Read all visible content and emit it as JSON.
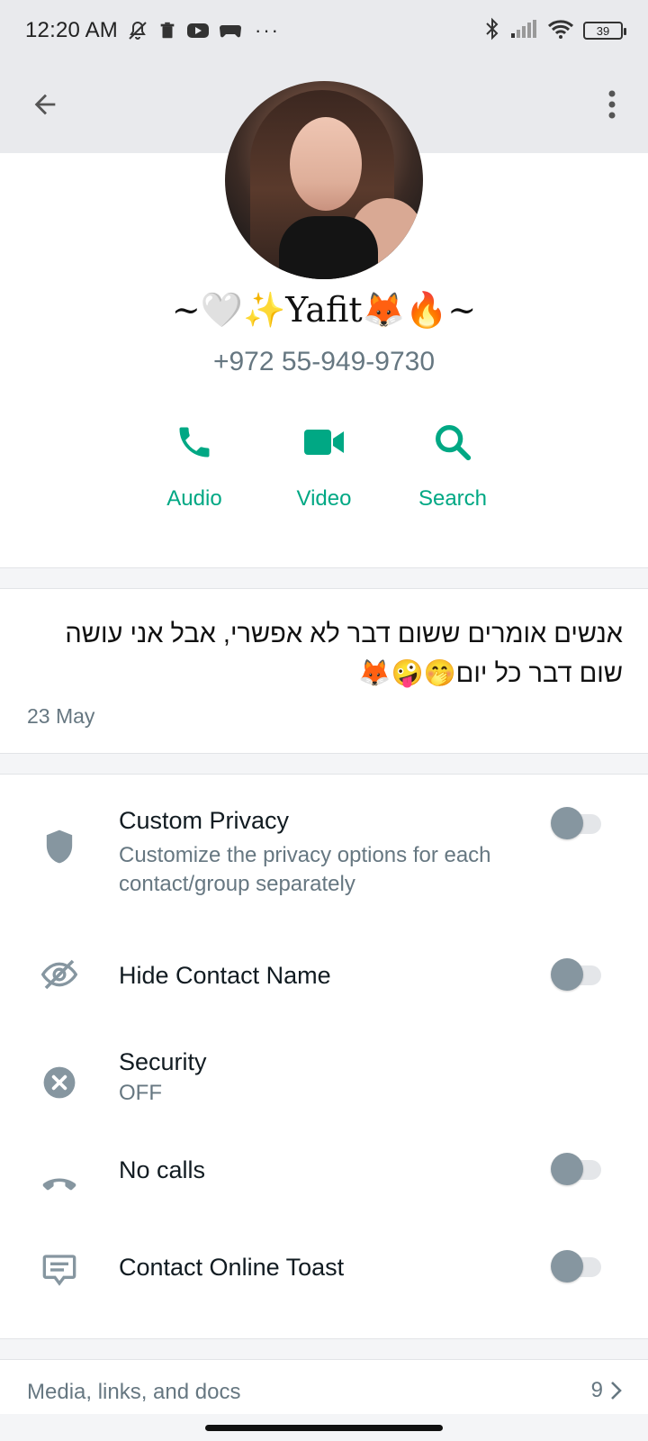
{
  "status_bar": {
    "time": "12:20 AM",
    "icons_left": [
      "mute-icon",
      "trash-icon",
      "youtube-icon",
      "gamepad-icon"
    ],
    "more": "···",
    "icons_right": [
      "bluetooth-icon",
      "signal-icon",
      "wifi-icon"
    ],
    "battery": "39"
  },
  "app_bar": {
    "back_icon": "arrow-left-icon",
    "menu_icon": "more-vert-icon"
  },
  "profile": {
    "name": "~🤍✨Yafit🦊🔥~",
    "phone": "+972 55-949-9730"
  },
  "actions": [
    {
      "label": "Audio",
      "icon": "phone-icon"
    },
    {
      "label": "Video",
      "icon": "video-camera-icon"
    },
    {
      "label": "Search",
      "icon": "search-icon"
    }
  ],
  "about": {
    "text": "אנשים אומרים ששום דבר לא אפשרי, אבל אני עושה שום דבר כל יום🤭🤪🦊",
    "date": "23 May"
  },
  "settings": [
    {
      "title": "Custom Privacy",
      "subtitle": "Customize the privacy options for each contact/group separately",
      "icon": "shield-icon",
      "toggle": false
    },
    {
      "title": "Hide Contact Name",
      "icon": "eye-off-icon",
      "toggle": false
    },
    {
      "title": "Security",
      "subtitle": "OFF",
      "icon": "close-circle-icon"
    },
    {
      "title": "No calls",
      "icon": "call-end-icon",
      "toggle": false
    },
    {
      "title": "Contact Online Toast",
      "icon": "message-icon",
      "toggle": false
    }
  ],
  "media": {
    "label": "Media, links, and docs",
    "count": "9"
  },
  "colors": {
    "accent": "#00a884",
    "icon_gray": "#8696a0",
    "secondary_text": "#667781"
  }
}
